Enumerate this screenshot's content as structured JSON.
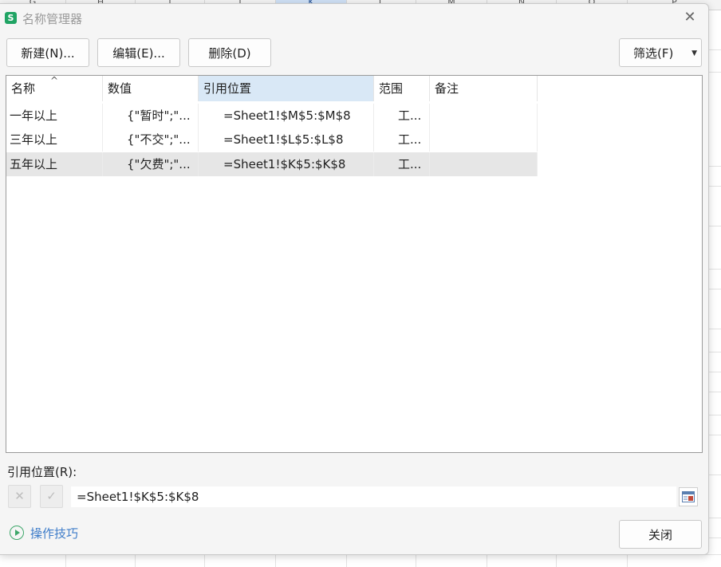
{
  "sheet": {
    "columns": [
      "G",
      "H",
      "I",
      "J",
      "K",
      "L",
      "M",
      "N",
      "O",
      "P"
    ],
    "selected_column": "K"
  },
  "dialog": {
    "title": "名称管理器",
    "app_icon_letter": "S",
    "close_glyph": "✕"
  },
  "toolbar": {
    "new_label": "新建(N)...",
    "edit_label": "编辑(E)...",
    "delete_label": "删除(D)",
    "filter_label": "筛选(F)",
    "filter_caret": "▼"
  },
  "list": {
    "sort_indicator": "^",
    "columns": [
      "名称",
      "数值",
      "引用位置",
      "范围",
      "备注"
    ],
    "active_column": "引用位置",
    "rows": [
      {
        "name": "一年以上",
        "value": "{\"暂时\";\"...",
        "ref": "=Sheet1!$M$5:$M$8",
        "scope": "工...",
        "note": ""
      },
      {
        "name": "三年以上",
        "value": "{\"不交\";\"...",
        "ref": "=Sheet1!$L$5:$L$8",
        "scope": "工...",
        "note": ""
      },
      {
        "name": "五年以上",
        "value": "{\"欠费\";\"...",
        "ref": "=Sheet1!$K$5:$K$8",
        "scope": "工...",
        "note": ""
      }
    ],
    "selected_row": 2
  },
  "refers_to": {
    "label": "引用位置(R):",
    "value": "=Sheet1!$K$5:$K$8",
    "cancel_glyph": "✕",
    "confirm_glyph": "✓"
  },
  "footer": {
    "tips_label": "操作技巧",
    "close_label": "关闭"
  },
  "colors": {
    "accent_link": "#3d7cc9",
    "tips_icon": "#3ea76a",
    "app_icon": "#20a464",
    "active_header": "#d9e8f6",
    "selected_row": "#e6e6e6"
  }
}
